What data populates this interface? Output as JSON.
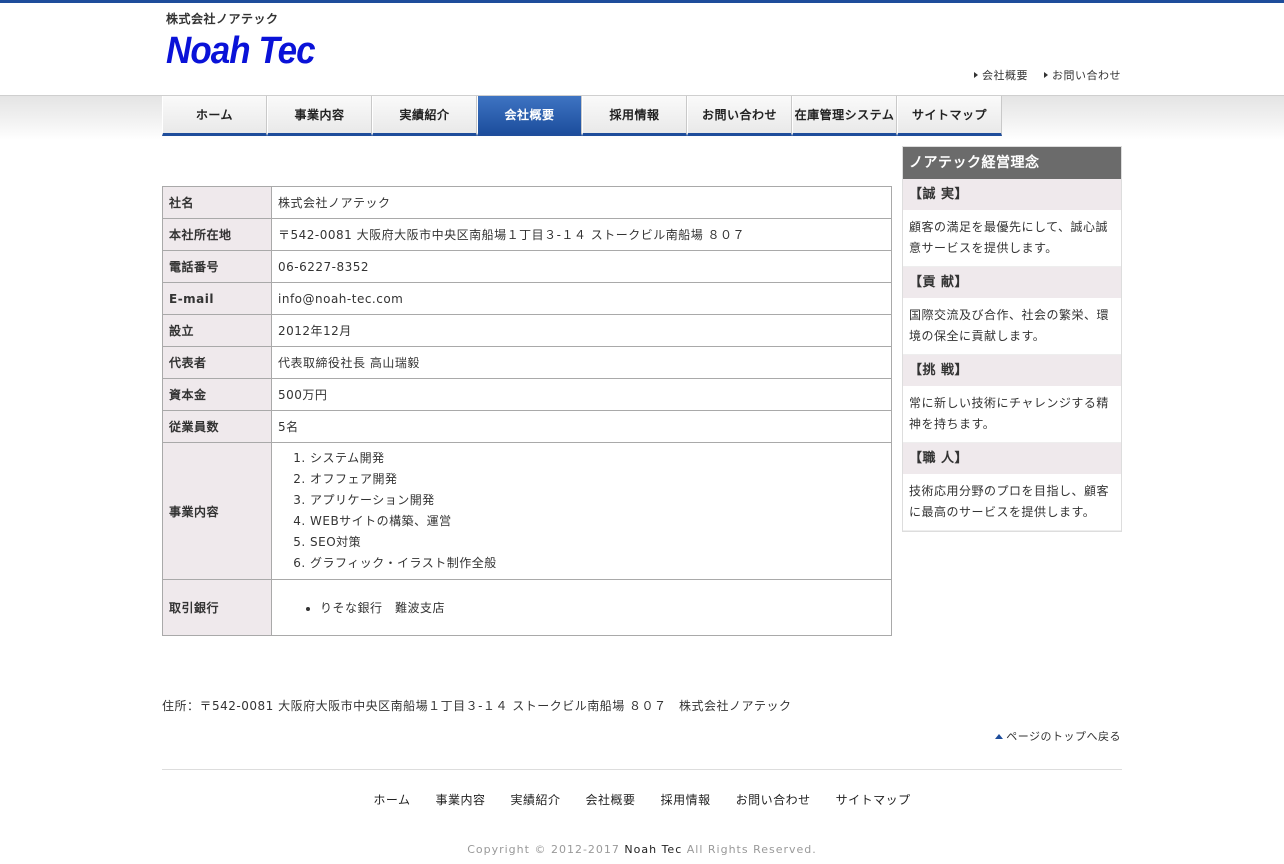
{
  "header": {
    "tagline": "株式会社ノアテック",
    "logo": "Noah Tec",
    "links": [
      "会社概要",
      "お問い合わせ"
    ]
  },
  "nav": {
    "items": [
      "ホーム",
      "事業内容",
      "実績紹介",
      "会社概要",
      "採用情報",
      "お問い合わせ",
      "在庫管理システム",
      "サイトマップ"
    ],
    "active": "会社概要"
  },
  "company": {
    "rows": [
      {
        "label": "社名",
        "value": "株式会社ノアテック"
      },
      {
        "label": "本社所在地",
        "value": "〒542-0081 大阪府大阪市中央区南船場１丁目３-１４ ストークビル南船場 ８０７"
      },
      {
        "label": "電話番号",
        "value": "06-6227-8352"
      },
      {
        "label": "E-mail",
        "value": "info@noah-tec.com"
      },
      {
        "label": "設立",
        "value": "2012年12月"
      },
      {
        "label": "代表者",
        "value": "代表取締役社長 高山瑞毅"
      },
      {
        "label": "資本金",
        "value": "500万円"
      },
      {
        "label": "従業員数",
        "value": "5名"
      }
    ],
    "business_label": "事業内容",
    "business_items": [
      "システム開発",
      "オフフェア開発",
      "アプリケーション開発",
      "WEBサイトの構築、運営",
      "SEO対策",
      "グラフィック・イラスト制作全般"
    ],
    "bank_label": "取引銀行",
    "bank_items": [
      "りそな銀行　難波支店"
    ]
  },
  "sidebar": {
    "title": "ノアテック経営理念",
    "items": [
      {
        "heading": "【誠 実】",
        "text": "顧客の満足を最優先にして、誠心誠意サービスを提供します。"
      },
      {
        "heading": "【貢 献】",
        "text": "国際交流及び合作、社会の繁栄、環境の保全に貢献します。"
      },
      {
        "heading": "【挑 戦】",
        "text": "常に新しい技術にチャレンジする精神を持ちます。"
      },
      {
        "heading": "【職 人】",
        "text": "技術応用分野のプロを目指し、顧客に最高のサービスを提供します。"
      }
    ]
  },
  "footer": {
    "address": "住所：〒542-0081 大阪府大阪市中央区南船場１丁目３-１４ ストークビル南船場 ８０７　株式会社ノアテック",
    "to_top": "ページのトップへ戻る",
    "nav": [
      "ホーム",
      "事業内容",
      "実績紹介",
      "会社概要",
      "採用情報",
      "お問い合わせ",
      "サイトマップ"
    ],
    "copyright_pre": "Copyright © 2012-2017",
    "copyright_brand": "Noah Tec",
    "copyright_post": "All Rights Reserved."
  }
}
